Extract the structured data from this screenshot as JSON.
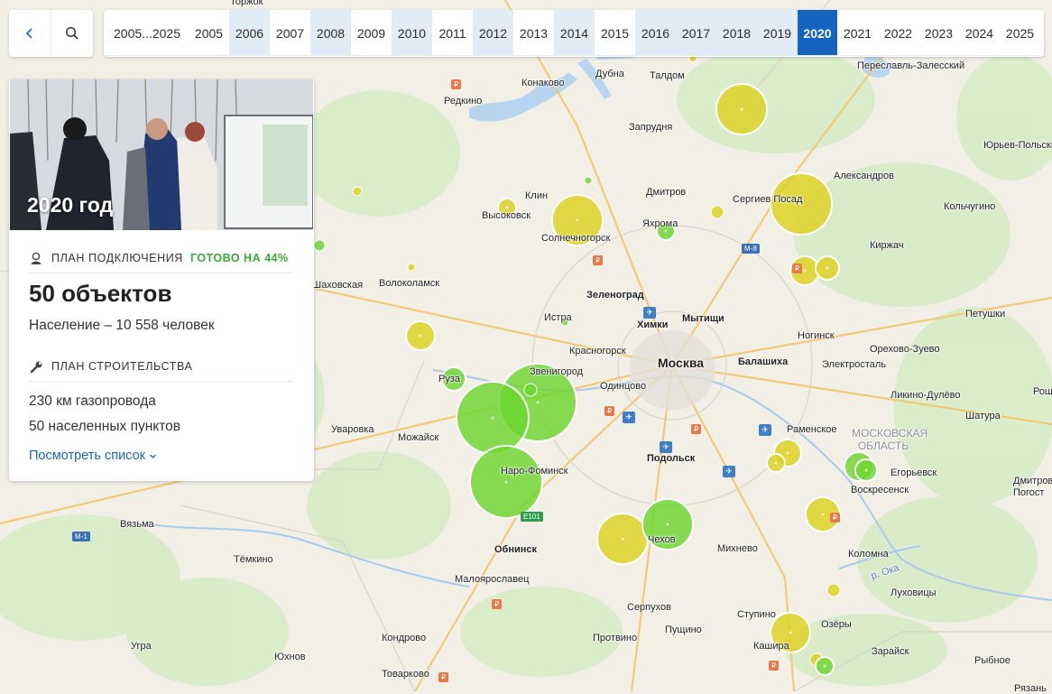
{
  "top_bar": {
    "back_icon": "chevron-left-icon",
    "search_icon": "search-icon",
    "years": [
      "2005...2025",
      "2005",
      "2006",
      "2007",
      "2008",
      "2009",
      "2010",
      "2011",
      "2012",
      "2013",
      "2014",
      "2015",
      "2016",
      "2017",
      "2018",
      "2019",
      "2020",
      "2021",
      "2022",
      "2023",
      "2024",
      "2025"
    ],
    "selected_year": "2020"
  },
  "card": {
    "photo_caption": "2020 год",
    "plan_connection_label": "ПЛАН ПОДКЛЮЧЕНИЯ",
    "ready_label": "ГОТОВО НА 44%",
    "ready_color": "#3aaa35",
    "objects": "50 объектов",
    "population": "Население – 10 558 человек",
    "construction_label": "ПЛАН СТРОИТЕЛЬСТВА",
    "pipeline": "230 км газопровода",
    "settlements": "50 населенных пунктов",
    "view_list": "Посмотреть список"
  },
  "map": {
    "markers_color_done": "#6cd62e",
    "markers_color_planned": "#dcd21e",
    "cities": [
      {
        "name": "Торжок",
        "cls": ""
      },
      {
        "name": "Переславль-Залесский",
        "cls": ""
      },
      {
        "name": "Дубна",
        "cls": ""
      },
      {
        "name": "Талдом",
        "cls": ""
      },
      {
        "name": "Конаково",
        "cls": ""
      },
      {
        "name": "Редкино",
        "cls": ""
      },
      {
        "name": "Запрудня",
        "cls": ""
      },
      {
        "name": "Юрьев-Польский",
        "cls": ""
      },
      {
        "name": "Александров",
        "cls": ""
      },
      {
        "name": "Клин",
        "cls": ""
      },
      {
        "name": "Дмитров",
        "cls": ""
      },
      {
        "name": "Сергиев Посад",
        "cls": ""
      },
      {
        "name": "Кольчугино",
        "cls": ""
      },
      {
        "name": "Высоковск",
        "cls": ""
      },
      {
        "name": "Яхрома",
        "cls": ""
      },
      {
        "name": "Солнечногорск",
        "cls": ""
      },
      {
        "name": "Киржач",
        "cls": ""
      },
      {
        "name": "Шаховская",
        "cls": ""
      },
      {
        "name": "Волоколамск",
        "cls": ""
      },
      {
        "name": "Зеленоград",
        "cls": "bold"
      },
      {
        "name": "Петушки",
        "cls": ""
      },
      {
        "name": "Истра",
        "cls": ""
      },
      {
        "name": "Химки",
        "cls": "bold"
      },
      {
        "name": "Мытищи",
        "cls": "bold"
      },
      {
        "name": "Ногинск",
        "cls": ""
      },
      {
        "name": "Красногорск",
        "cls": ""
      },
      {
        "name": "Орехово-Зуево",
        "cls": ""
      },
      {
        "name": "Москва",
        "cls": "big"
      },
      {
        "name": "Балашиха",
        "cls": "bold"
      },
      {
        "name": "Руза",
        "cls": ""
      },
      {
        "name": "Звенигород",
        "cls": ""
      },
      {
        "name": "Одинцово",
        "cls": ""
      },
      {
        "name": "Электросталь",
        "cls": ""
      },
      {
        "name": "Ликино-Дулёво",
        "cls": ""
      },
      {
        "name": "Уваровка",
        "cls": ""
      },
      {
        "name": "Можайск",
        "cls": ""
      },
      {
        "name": "Шатура",
        "cls": ""
      },
      {
        "name": "Раменское",
        "cls": ""
      },
      {
        "name": "Подольск",
        "cls": "bold"
      },
      {
        "name": "Наро-Фоминск",
        "cls": ""
      },
      {
        "name": "Егорьевск",
        "cls": ""
      },
      {
        "name": "Воскресенск",
        "cls": ""
      },
      {
        "name": "Вязьма",
        "cls": ""
      },
      {
        "name": "Обнинск",
        "cls": "bold"
      },
      {
        "name": "Чехов",
        "cls": ""
      },
      {
        "name": "Михнево",
        "cls": ""
      },
      {
        "name": "Тёмкино",
        "cls": ""
      },
      {
        "name": "Коломна",
        "cls": ""
      },
      {
        "name": "Малоярославец",
        "cls": ""
      },
      {
        "name": "Луховицы",
        "cls": ""
      },
      {
        "name": "Серпухов",
        "cls": ""
      },
      {
        "name": "Ступино",
        "cls": ""
      },
      {
        "name": "Озёры",
        "cls": ""
      },
      {
        "name": "Пущино",
        "cls": ""
      },
      {
        "name": "Кондрово",
        "cls": ""
      },
      {
        "name": "Протвино",
        "cls": ""
      },
      {
        "name": "Угра",
        "cls": ""
      },
      {
        "name": "Кашира",
        "cls": ""
      },
      {
        "name": "Зарайск",
        "cls": ""
      },
      {
        "name": "Юхнов",
        "cls": ""
      },
      {
        "name": "Рыбное",
        "cls": ""
      },
      {
        "name": "Товарково",
        "cls": ""
      },
      {
        "name": "Рязань",
        "cls": ""
      },
      {
        "name": "Дмитров Погост",
        "cls": ""
      },
      {
        "name": "Рош",
        "cls": ""
      },
      {
        "name": "МОСКОВСКАЯ ОБЛАСТЬ",
        "cls": "region"
      }
    ],
    "road_signs": [
      "M-8",
      "M-1",
      "E101"
    ],
    "river_label": "р. Ока"
  }
}
